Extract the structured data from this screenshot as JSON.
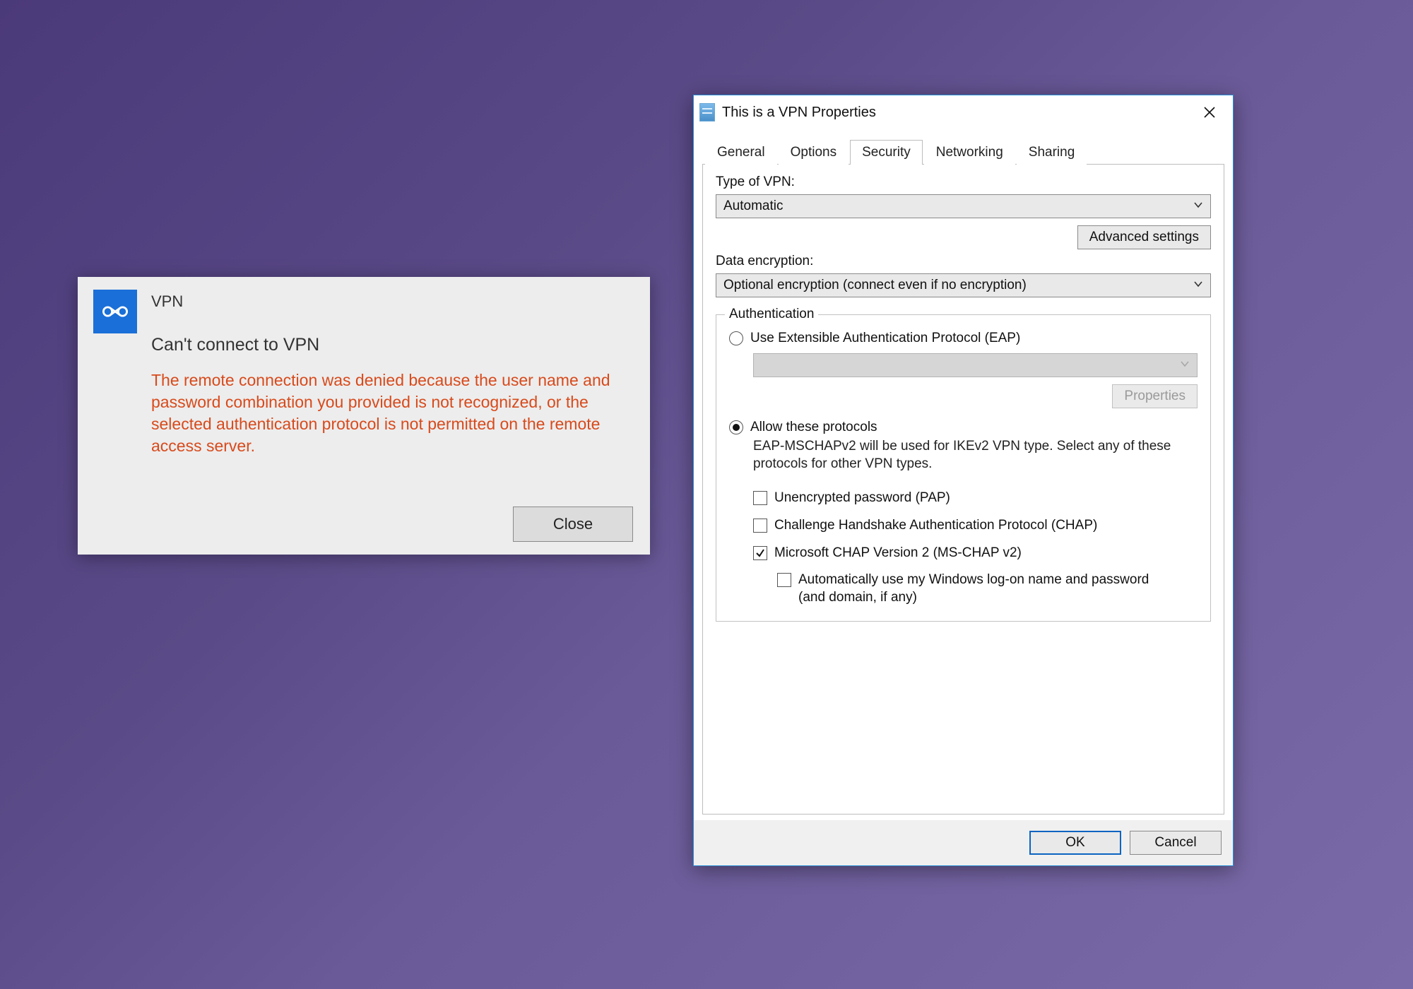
{
  "toast": {
    "app_name": "VPN",
    "heading": "Can't connect to VPN",
    "error_text": "The remote connection was denied because the user name and password combination you provided is not recognized, or the selected authentication protocol is not permitted on the remote access server.",
    "close_label": "Close"
  },
  "dialog": {
    "title": "This is a VPN Properties",
    "tabs": {
      "general": "General",
      "options": "Options",
      "security": "Security",
      "networking": "Networking",
      "sharing": "Sharing"
    },
    "type_of_vpn_label": "Type of VPN:",
    "type_of_vpn_value": "Automatic",
    "advanced_settings_label": "Advanced settings",
    "data_encryption_label": "Data encryption:",
    "data_encryption_value": "Optional encryption (connect even if no encryption)",
    "auth_legend": "Authentication",
    "auth_eap_label": "Use Extensible Authentication Protocol (EAP)",
    "auth_properties_label": "Properties",
    "auth_allow_label": "Allow these protocols",
    "auth_allow_hint": "EAP-MSCHAPv2 will be used for IKEv2 VPN type. Select any of these protocols for other VPN types.",
    "chk_pap": "Unencrypted password (PAP)",
    "chk_chap": "Challenge Handshake Authentication Protocol (CHAP)",
    "chk_mschap": "Microsoft CHAP Version 2 (MS-CHAP v2)",
    "chk_autologon": "Automatically use my Windows log-on name and password (and domain, if any)",
    "ok_label": "OK",
    "cancel_label": "Cancel"
  }
}
